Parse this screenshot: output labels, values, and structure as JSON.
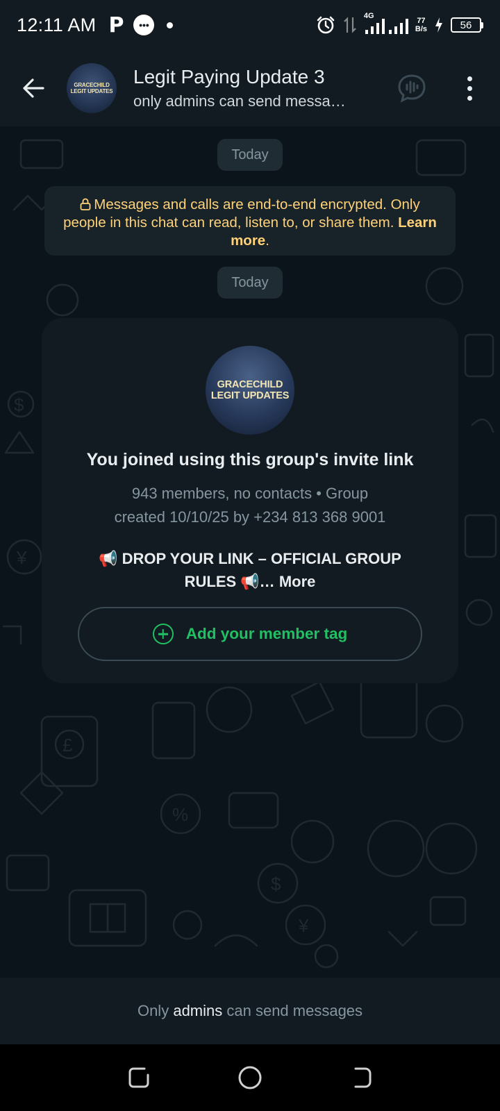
{
  "status_bar": {
    "time": "12:11 AM",
    "network_label": "4G",
    "net_speed_value": "77",
    "net_speed_unit": "B/s",
    "battery": "56",
    "icons": [
      "p-app-icon",
      "chat-bubble-icon",
      "dot-icon",
      "alarm-icon",
      "data-arrows-icon",
      "signal-icon",
      "signal-icon-2",
      "charging-icon",
      "battery-icon"
    ]
  },
  "header": {
    "title": "Legit Paying Update 3",
    "subtitle": "only admins can send messa…",
    "avatar_line1": "GRACECHILD",
    "avatar_line2": "LEGIT UPDATES",
    "icons": [
      "back-arrow-icon",
      "voice-chat-icon",
      "more-vert-icon"
    ]
  },
  "chat": {
    "date_chip_1": "Today",
    "encryption_text": "Messages and calls are end-to-end encrypted. Only people in this chat can read, listen to, or share them.",
    "encryption_link": "Learn more",
    "encryption_period": ".",
    "date_chip_2": "Today",
    "card": {
      "avatar_line1": "GRACECHILD",
      "avatar_line2": "LEGIT UPDATES",
      "joined_text": "You joined using this group's invite link",
      "meta_line1": "943 members, no contacts • Group",
      "meta_line2": "created 10/10/25 by +234 813 368 9001",
      "rules_prefix": "📢 DROP YOUR LINK – OFFICIAL GROUP",
      "rules_line2": "RULES 📢…",
      "more_label": "More",
      "member_tag_label": "Add your member tag"
    }
  },
  "footer": {
    "text_before": "Only",
    "text_highlight": "admins",
    "text_after": "can send messages"
  },
  "colors": {
    "background": "#0b141a",
    "bar": "#111b21",
    "accent_green": "#21c063",
    "encryption_yellow": "#ffd279"
  }
}
